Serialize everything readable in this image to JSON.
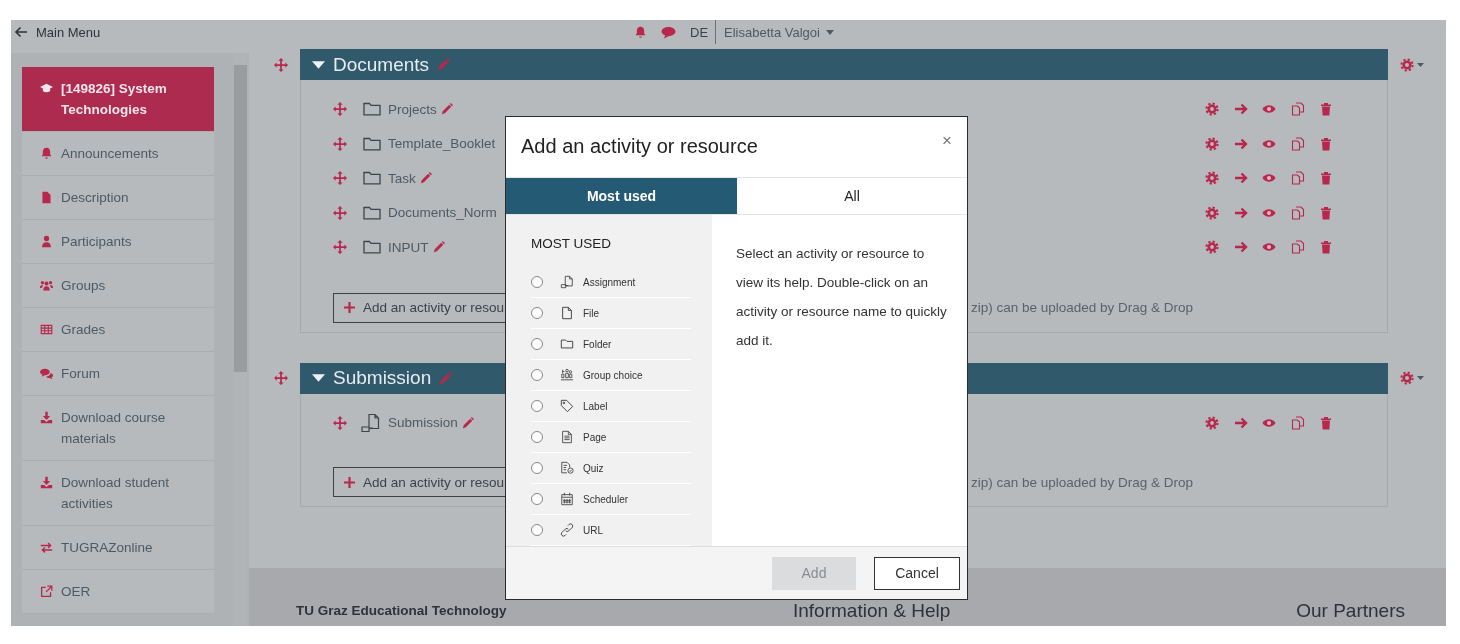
{
  "top_bar": {
    "back_link": "Main Menu",
    "language": "DE",
    "user": "Elisabetta Valgoi"
  },
  "sidebar": {
    "items": [
      {
        "label": "[149826] System Technologies",
        "kind": "course",
        "selected": true
      },
      {
        "label": "Announcements",
        "kind": "bell",
        "selected": false
      },
      {
        "label": "Description",
        "kind": "file",
        "selected": false
      },
      {
        "label": "Participants",
        "kind": "user",
        "selected": false
      },
      {
        "label": "Groups",
        "kind": "users",
        "selected": false
      },
      {
        "label": "Grades",
        "kind": "table",
        "selected": false
      },
      {
        "label": "Forum",
        "kind": "comments",
        "selected": false
      },
      {
        "label": "Download course materials",
        "kind": "download",
        "selected": false
      },
      {
        "label": "Download student activities",
        "kind": "download",
        "selected": false
      },
      {
        "label": "TUGRAZonline",
        "kind": "exchange",
        "selected": false
      },
      {
        "label": "OER",
        "kind": "external",
        "selected": false
      }
    ]
  },
  "sections": [
    {
      "title": "Documents",
      "items": [
        {
          "name": "Projects",
          "kind": "folder",
          "pencil": true
        },
        {
          "name": "Template_Booklet",
          "kind": "folder",
          "pencil": false
        },
        {
          "name": "Task",
          "kind": "folder",
          "pencil": true
        },
        {
          "name": "Documents_Norm",
          "kind": "folder",
          "pencil": false
        },
        {
          "name": "INPUT",
          "kind": "folder",
          "pencil": true
        }
      ],
      "add_button": "Add an activity or resou",
      "drop_hint": "zip) can be uploaded by Drag & Drop"
    },
    {
      "title": "Submission",
      "items": [
        {
          "name": "Submission",
          "kind": "assignment",
          "pencil": true
        }
      ],
      "add_button": "Add an activity or resou",
      "drop_hint": "zip) can be uploaded by Drag & Drop"
    }
  ],
  "footer": {
    "columns": [
      "TU Graz Educational Technology",
      "Information & Help",
      "Our Partners"
    ]
  },
  "dialog": {
    "title": "Add an activity or resource",
    "close": "×",
    "tabs": [
      {
        "label": "Most used",
        "selected": true
      },
      {
        "label": "All",
        "selected": false
      }
    ],
    "list_heading": "MOST USED",
    "options": [
      {
        "label": "Assignment",
        "kind": "assignment",
        "selected": false
      },
      {
        "label": "File",
        "kind": "file",
        "selected": false
      },
      {
        "label": "Folder",
        "kind": "folder",
        "selected": false
      },
      {
        "label": "Group choice",
        "kind": "group",
        "selected": false
      },
      {
        "label": "Label",
        "kind": "label",
        "selected": false
      },
      {
        "label": "Page",
        "kind": "page",
        "selected": false
      },
      {
        "label": "Quiz",
        "kind": "quiz",
        "selected": false
      },
      {
        "label": "Scheduler",
        "kind": "scheduler",
        "selected": false
      },
      {
        "label": "URL",
        "kind": "url",
        "selected": false
      }
    ],
    "help_text": "Select an activity or resource to view its help. Double-click on an activity or resource name to quickly add it.",
    "buttons": [
      {
        "label": "Add",
        "disabled": true
      },
      {
        "label": "Cancel",
        "disabled": false
      }
    ]
  }
}
